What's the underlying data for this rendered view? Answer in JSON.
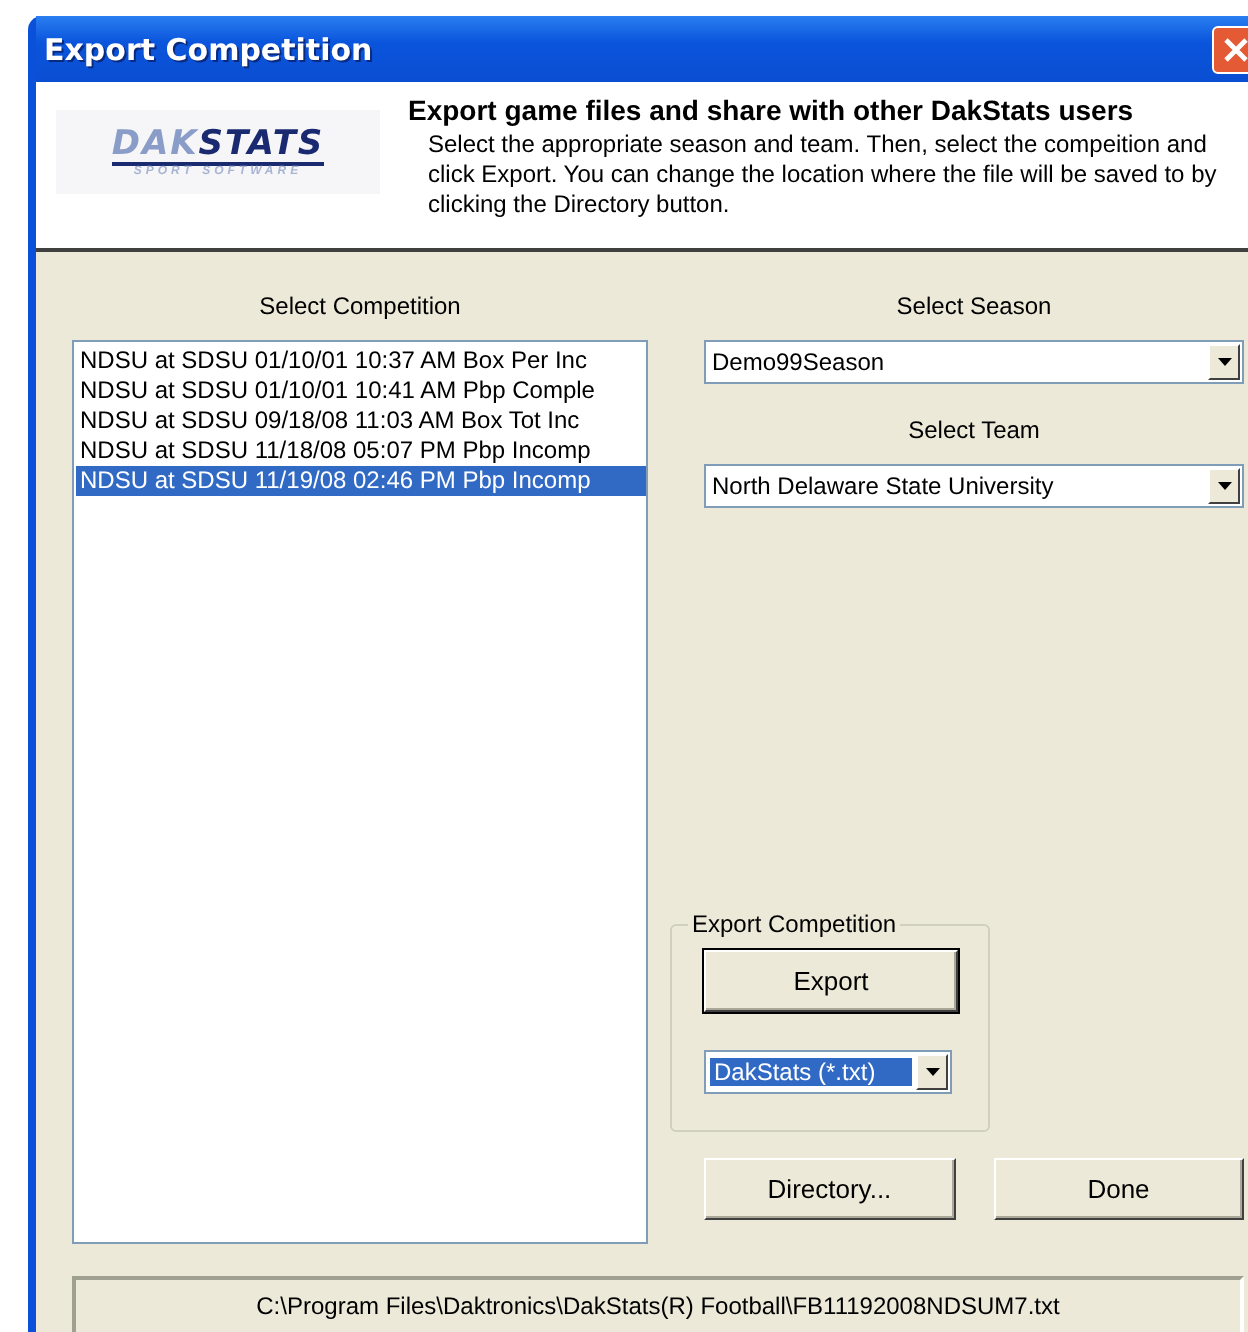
{
  "window": {
    "title": "Export Competition"
  },
  "header": {
    "logo": {
      "word_1": "DAK",
      "word_2": "STATS",
      "tagline": "SPORT SOFTWARE"
    },
    "heading": "Export game files and share with other DakStats users",
    "description": "Select the appropriate season and team.  Then, select the compeition and click Export.  You can change the location where the file will be saved to by clicking the Directory button."
  },
  "competition_list": {
    "label": "Select Competition",
    "items": [
      {
        "text": "NDSU at SDSU 01/10/01 10:37 AM  Box Per Inc",
        "selected": false
      },
      {
        "text": "NDSU at SDSU 01/10/01 10:41 AM  Pbp Comple",
        "selected": false
      },
      {
        "text": "NDSU at SDSU 09/18/08 11:03 AM  Box Tot Inc",
        "selected": false
      },
      {
        "text": "NDSU at SDSU 11/18/08 05:07 PM  Pbp Incomp",
        "selected": false
      },
      {
        "text": "NDSU at SDSU 11/19/08 02:46 PM  Pbp Incomp",
        "selected": true
      }
    ]
  },
  "season": {
    "label": "Select Season",
    "value": "Demo99Season"
  },
  "team": {
    "label": "Select Team",
    "value": "North Delaware State University"
  },
  "export_group": {
    "label": "Export Competition",
    "button": "Export",
    "format": "DakStats (*.txt)"
  },
  "buttons": [
    "Directory...",
    "Done"
  ],
  "status_bar": "C:\\Program Files\\Daktronics\\DakStats(R) Football\\FB11192008NDSUM7.txt"
}
